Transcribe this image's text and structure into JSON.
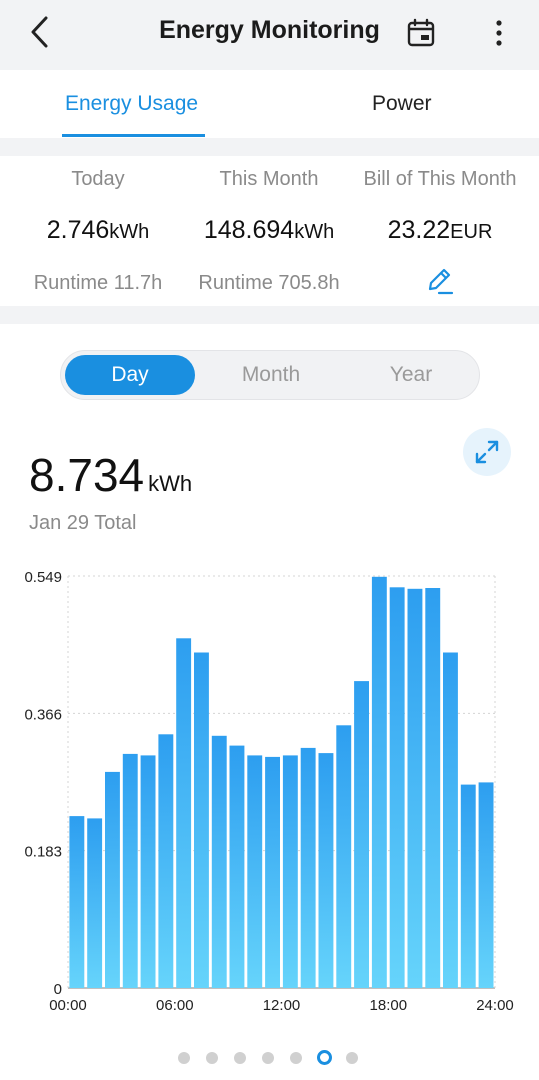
{
  "header": {
    "title": "Energy Monitoring"
  },
  "tabs": [
    {
      "label": "Energy Usage",
      "active": true
    },
    {
      "label": "Power",
      "active": false
    }
  ],
  "stats": [
    {
      "label": "Today",
      "value": "2.746",
      "unit": "kWh",
      "runtime": "Runtime 11.7h"
    },
    {
      "label": "This Month",
      "value": "148.694",
      "unit": "kWh",
      "runtime": "Runtime 705.8h"
    },
    {
      "label": "Bill of This Month",
      "value": "23.22",
      "unit": "EUR",
      "runtime": ""
    }
  ],
  "period_selector": {
    "options": [
      "Day",
      "Month",
      "Year"
    ],
    "selected": "Day"
  },
  "summary": {
    "value": "8.734",
    "unit": "kWh",
    "caption": "Jan 29 Total"
  },
  "colors": {
    "accent": "#1a8fe0",
    "bar_top": "#2d9ef0",
    "bar_bottom": "#66d4fb"
  },
  "icons": [
    "back-arrow-icon",
    "calendar-icon",
    "more-vertical-icon",
    "edit-pencil-icon",
    "expand-icon"
  ],
  "pager": {
    "count": 7,
    "active_index": 5
  },
  "chart_data": {
    "type": "bar",
    "x": [
      0,
      1,
      2,
      3,
      4,
      5,
      6,
      7,
      8,
      9,
      10,
      11,
      12,
      13,
      14,
      15,
      16,
      17,
      18,
      19,
      20,
      21,
      22,
      23
    ],
    "x_ticks": [
      "00:00",
      "06:00",
      "12:00",
      "18:00",
      "24:00"
    ],
    "y_ticks": [
      "0",
      "0.183",
      "0.366",
      "0.549"
    ],
    "values": [
      0.229,
      0.226,
      0.288,
      0.312,
      0.31,
      0.338,
      0.466,
      0.447,
      0.336,
      0.323,
      0.31,
      0.308,
      0.31,
      0.32,
      0.313,
      0.35,
      0.409,
      0.548,
      0.534,
      0.532,
      0.533,
      0.447,
      0.271,
      0.274
    ],
    "ylim": [
      0,
      0.549
    ],
    "grid": true,
    "xlabel": "",
    "ylabel": ""
  }
}
